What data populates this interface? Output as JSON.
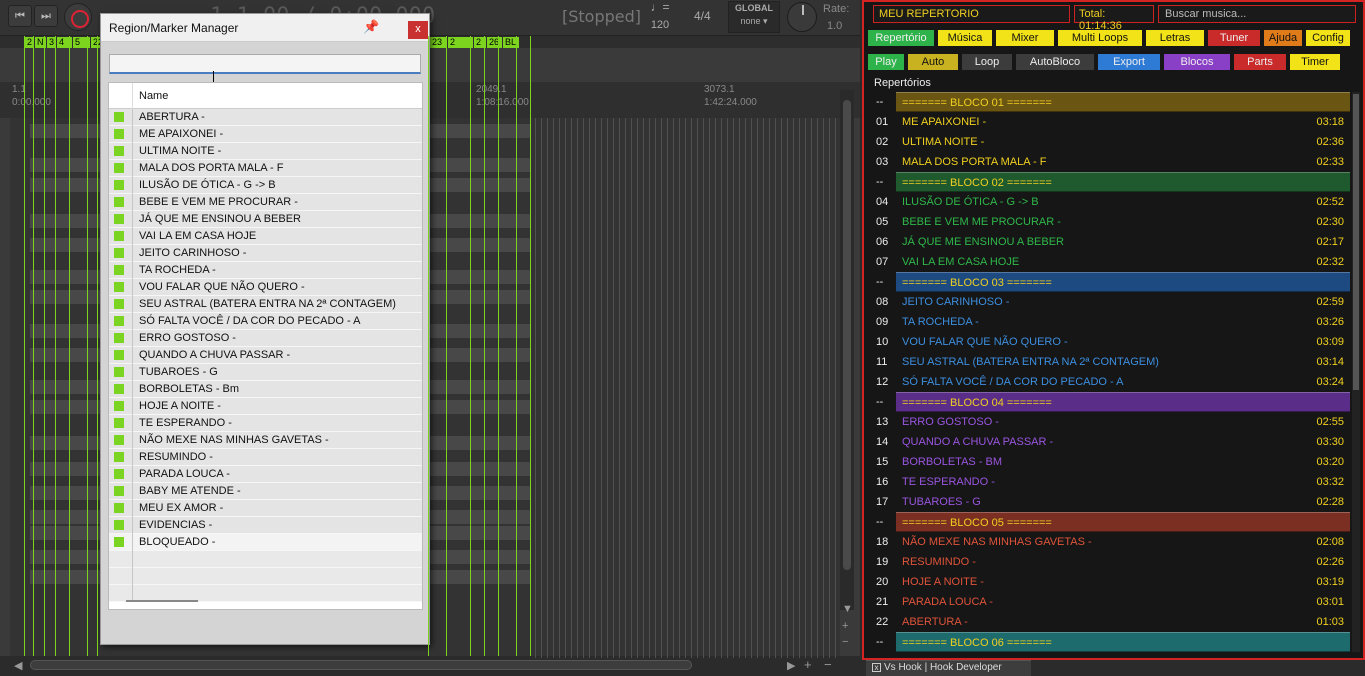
{
  "transport": {
    "status": "[Stopped]",
    "bpm": "120",
    "time_signature": "4/4",
    "global_label": "GLOBAL",
    "global_value": "none",
    "rate_label": "Rate:",
    "rate_value": "1.0",
    "timecode": "1.1.00 / 0:00.000"
  },
  "arrange": {
    "markers": [
      "2",
      "N",
      "3",
      "4",
      "5",
      "22",
      "23",
      "2",
      "2",
      "26",
      "BL"
    ],
    "ruler": [
      {
        "bar": "1.1",
        "time": "0:00.000"
      },
      {
        "bar": "2049.1",
        "time": "1:08:16.000"
      },
      {
        "bar": "3073.1",
        "time": "1:42:24.000"
      }
    ]
  },
  "dialog": {
    "title": "Region/Marker Manager",
    "close_label": "x",
    "search_value": "",
    "column_name": "Name",
    "items": [
      "ABERTURA -",
      "ME APAIXONEI -",
      "ULTIMA NOITE -",
      "MALA DOS PORTA MALA - F",
      "ILUSÃO DE ÓTICA - G -> B",
      "BEBE E VEM ME PROCURAR -",
      "JÁ QUE ME ENSINOU A BEBER",
      "VAI LA EM CASA HOJE",
      "JEITO CARINHOSO -",
      "TA ROCHEDA -",
      "VOU FALAR QUE NÃO QUERO -",
      "SEU ASTRAL (BATERA ENTRA NA 2ª CONTAGEM)",
      "SÓ FALTA VOCÊ / DA COR DO PECADO - A",
      "ERRO GOSTOSO -",
      "QUANDO A CHUVA PASSAR -",
      "TUBAROES - G",
      "BORBOLETAS - Bm",
      "HOJE A NOITE -",
      "TE ESPERANDO -",
      "NÃO MEXE NAS MINHAS GAVETAS -",
      "RESUMINDO -",
      "PARADA LOUCA -",
      "BABY ME ATENDE -",
      "MEU EX AMOR -",
      "EVIDENCIAS -",
      "BLOQUEADO -"
    ]
  },
  "repertoire": {
    "name": "MEU REPERTORIO",
    "total": "Total: 01:14:36",
    "search_placeholder": "Buscar musica...",
    "section_label": "Repertórios",
    "buttons_row1": [
      {
        "label": "Repertório",
        "color": "#2db34a"
      },
      {
        "label": "Música",
        "color": "#f2e318"
      },
      {
        "label": "Mixer",
        "color": "#f2e318"
      },
      {
        "label": "Multi Loops",
        "color": "#f2e318"
      },
      {
        "label": "Letras",
        "color": "#f2e318"
      },
      {
        "label": "Tuner",
        "color": "#c92a2a"
      },
      {
        "label": "Ajuda",
        "color": "#e07b1a"
      },
      {
        "label": "Config",
        "color": "#f2e318"
      }
    ],
    "buttons_row2": [
      {
        "label": "Play",
        "color": "#2db34a"
      },
      {
        "label": "Auto",
        "color": "#c9b21f"
      },
      {
        "label": "Loop",
        "color": "#3c3c3c"
      },
      {
        "label": "AutoBloco",
        "color": "#3c3c3c"
      },
      {
        "label": "Export",
        "color": "#2e7bd6"
      },
      {
        "label": "Blocos",
        "color": "#8a3fc7"
      },
      {
        "label": "Parts",
        "color": "#c92a2a"
      },
      {
        "label": "Timer",
        "color": "#f2e318"
      }
    ],
    "rows": [
      {
        "type": "block",
        "num": "--",
        "title": "======= BLOCO 01 =======",
        "bg": "#6b5513",
        "fg": "#f0d020"
      },
      {
        "type": "song",
        "num": "01",
        "title": "ME APAIXONEI -",
        "dur": "03:18",
        "fg": "#f0d020"
      },
      {
        "type": "song",
        "num": "02",
        "title": "ULTIMA NOITE -",
        "dur": "02:36",
        "fg": "#f0d020"
      },
      {
        "type": "song",
        "num": "03",
        "title": "MALA DOS PORTA MALA - F",
        "dur": "02:33",
        "fg": "#f0d020"
      },
      {
        "type": "block",
        "num": "--",
        "title": "======= BLOCO 02 =======",
        "bg": "#1f5a2f",
        "fg": "#f0d020"
      },
      {
        "type": "song",
        "num": "04",
        "title": "ILUSÃO DE ÓTICA - G -> B",
        "dur": "02:52",
        "fg": "#2fb84a"
      },
      {
        "type": "song",
        "num": "05",
        "title": "BEBE E VEM ME PROCURAR -",
        "dur": "02:30",
        "fg": "#2fb84a"
      },
      {
        "type": "song",
        "num": "06",
        "title": "JÁ QUE ME ENSINOU A BEBER",
        "dur": "02:17",
        "fg": "#2fb84a"
      },
      {
        "type": "song",
        "num": "07",
        "title": "VAI LA EM CASA HOJE",
        "dur": "02:32",
        "fg": "#2fb84a"
      },
      {
        "type": "block",
        "num": "--",
        "title": "======= BLOCO 03 =======",
        "bg": "#1e4a82",
        "fg": "#f0d020"
      },
      {
        "type": "song",
        "num": "08",
        "title": "JEITO CARINHOSO -",
        "dur": "02:59",
        "fg": "#3d8fe0"
      },
      {
        "type": "song",
        "num": "09",
        "title": "TA ROCHEDA -",
        "dur": "03:26",
        "fg": "#3d8fe0"
      },
      {
        "type": "song",
        "num": "10",
        "title": "VOU FALAR QUE NÃO QUERO -",
        "dur": "03:09",
        "fg": "#3d8fe0"
      },
      {
        "type": "song",
        "num": "11",
        "title": "SEU ASTRAL (BATERA ENTRA NA 2ª CONTAGEM)",
        "dur": "03:14",
        "fg": "#3d8fe0"
      },
      {
        "type": "song",
        "num": "12",
        "title": "SÓ FALTA VOCÊ / DA COR DO PECADO - A",
        "dur": "03:24",
        "fg": "#3d8fe0"
      },
      {
        "type": "block",
        "num": "--",
        "title": "======= BLOCO 04 =======",
        "bg": "#5a2d88",
        "fg": "#f0d020"
      },
      {
        "type": "song",
        "num": "13",
        "title": "ERRO GOSTOSO -",
        "dur": "02:55",
        "fg": "#9a55e0"
      },
      {
        "type": "song",
        "num": "14",
        "title": "QUANDO A CHUVA PASSAR -",
        "dur": "03:30",
        "fg": "#9a55e0"
      },
      {
        "type": "song",
        "num": "15",
        "title": "BORBOLETAS - BM",
        "dur": "03:20",
        "fg": "#9a55e0"
      },
      {
        "type": "song",
        "num": "16",
        "title": "TE ESPERANDO -",
        "dur": "03:32",
        "fg": "#9a55e0"
      },
      {
        "type": "song",
        "num": "17",
        "title": "TUBAROES - G",
        "dur": "02:28",
        "fg": "#9a55e0"
      },
      {
        "type": "block",
        "num": "--",
        "title": "======= BLOCO 05 =======",
        "bg": "#7a2f22",
        "fg": "#f0d020"
      },
      {
        "type": "song",
        "num": "18",
        "title": "NÃO MEXE NAS MINHAS GAVETAS -",
        "dur": "02:08",
        "fg": "#e0543a"
      },
      {
        "type": "song",
        "num": "19",
        "title": "RESUMINDO -",
        "dur": "02:26",
        "fg": "#e0543a"
      },
      {
        "type": "song",
        "num": "20",
        "title": "HOJE A NOITE -",
        "dur": "03:19",
        "fg": "#e0543a"
      },
      {
        "type": "song",
        "num": "21",
        "title": "PARADA LOUCA -",
        "dur": "03:01",
        "fg": "#e0543a"
      },
      {
        "type": "song",
        "num": "22",
        "title": "ABERTURA -",
        "dur": "01:03",
        "fg": "#e0543a"
      },
      {
        "type": "block",
        "num": "--",
        "title": "======= BLOCO 06 =======",
        "bg": "#1e6b6e",
        "fg": "#f0d020"
      }
    ]
  },
  "bottom_tab": {
    "label": "Vs Hook | Hook Developer",
    "close_label": "x"
  }
}
